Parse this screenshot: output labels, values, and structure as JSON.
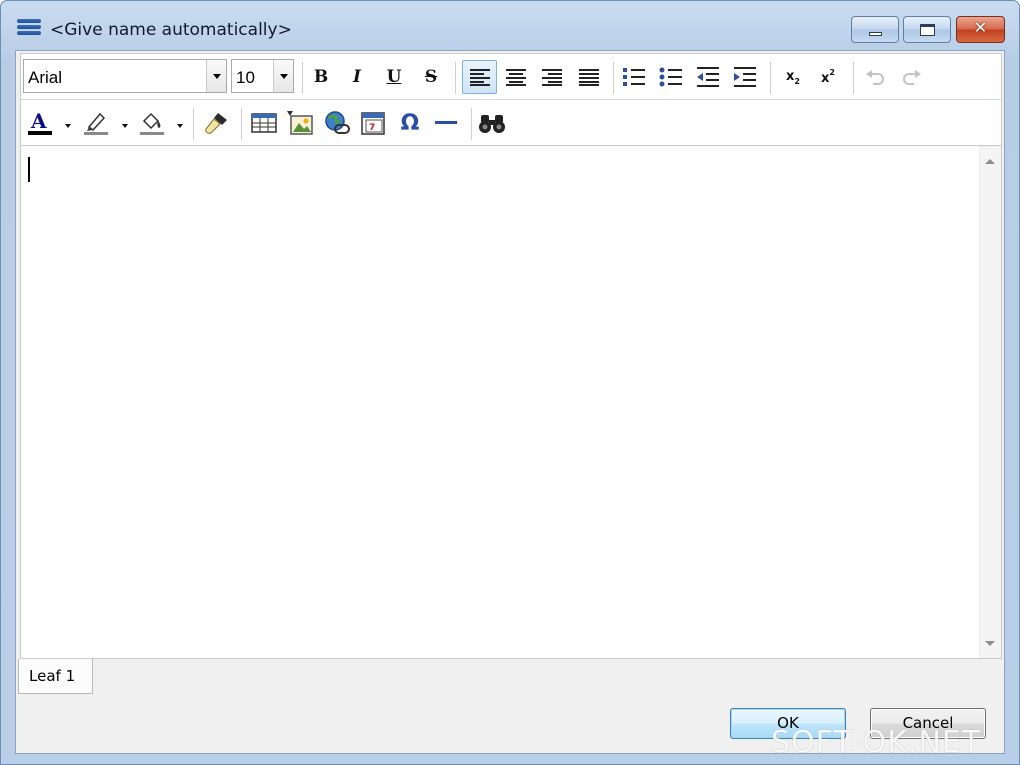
{
  "window": {
    "title": "<Give name automatically>",
    "close_glyph": "✕"
  },
  "toolbar": {
    "font_name": "Arial",
    "font_size": "10",
    "bold": "B",
    "italic": "I",
    "underline": "U",
    "strike": "S",
    "subscript_base": "x",
    "subscript_index": "2",
    "superscript_base": "x",
    "superscript_index": "2",
    "special_char": "Ω"
  },
  "icons": {
    "app": "app-menu-icon",
    "font_color": "font-color-icon",
    "highlight": "highlight-icon",
    "fill": "fill-icon",
    "format_painter": "format-painter-icon",
    "table": "table-icon",
    "image": "image-icon",
    "link": "link-icon",
    "date": "date-icon",
    "special_char": "omega-icon",
    "horizontal_line": "horizontal-line-icon",
    "find": "binoculars-icon"
  },
  "colors": {
    "accent": "#1f4f96",
    "font_color_bar": "#0a0a8a",
    "active_button": "#cfe4f8"
  },
  "tabs": [
    {
      "label": "Leaf 1"
    }
  ],
  "buttons": {
    "ok": "OK",
    "cancel": "Cancel"
  },
  "watermark": "SOFT-OK.NET"
}
